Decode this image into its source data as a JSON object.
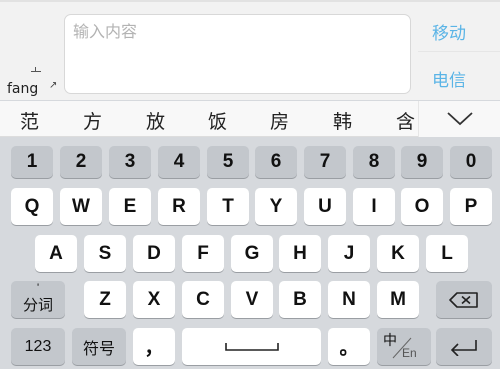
{
  "input": {
    "placeholder": "输入内容"
  },
  "side_options": [
    "移动",
    "电信"
  ],
  "composition": {
    "pinyin": "fang",
    "arrow": "↗"
  },
  "candidates": [
    "范",
    "方",
    "放",
    "饭",
    "房",
    "韩",
    "含"
  ],
  "keyboard": {
    "numbers": [
      "1",
      "2",
      "3",
      "4",
      "5",
      "6",
      "7",
      "8",
      "9",
      "0"
    ],
    "row1": [
      "Q",
      "W",
      "E",
      "R",
      "T",
      "Y",
      "U",
      "I",
      "O",
      "P"
    ],
    "row2": [
      "A",
      "S",
      "D",
      "F",
      "G",
      "H",
      "J",
      "K",
      "L"
    ],
    "row3": [
      "Z",
      "X",
      "C",
      "V",
      "B",
      "N",
      "M"
    ],
    "segment_label": "分词",
    "segment_hint": "'",
    "numeric_label": "123",
    "symbol_label": "符号",
    "comma": "，",
    "period": "。",
    "lang_zh": "中",
    "lang_en": "En"
  },
  "colors": {
    "accent": "#5ab4e6",
    "key_bg": "#ffffff",
    "func_key_bg": "#c3c7cc",
    "keyboard_bg": "#d6d9dd"
  }
}
